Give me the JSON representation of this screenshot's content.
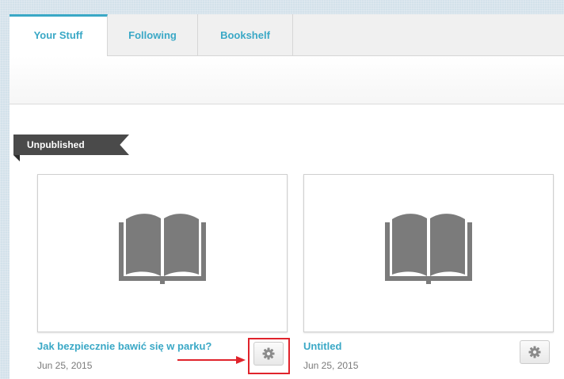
{
  "tabs": [
    {
      "label": "Your Stuff",
      "active": true
    },
    {
      "label": "Following",
      "active": false
    },
    {
      "label": "Bookshelf",
      "active": false
    }
  ],
  "section": {
    "label": "Unpublished"
  },
  "stories": [
    {
      "title": "Jak bezpiecznie bawić się w parku?",
      "date": "Jun 25, 2015",
      "cover_icon": "open-book-icon",
      "settings_icon": "gear-icon",
      "settings_highlighted": true
    },
    {
      "title": "Untitled",
      "date": "Jun 25, 2015",
      "cover_icon": "open-book-icon",
      "settings_icon": "gear-icon",
      "settings_highlighted": false
    }
  ],
  "colors": {
    "accent": "#3aa8c6",
    "ribbon": "#4a4a4a",
    "highlight": "#e0232b",
    "icon_gray": "#7b7b7b",
    "background": "#d3e1ea"
  }
}
